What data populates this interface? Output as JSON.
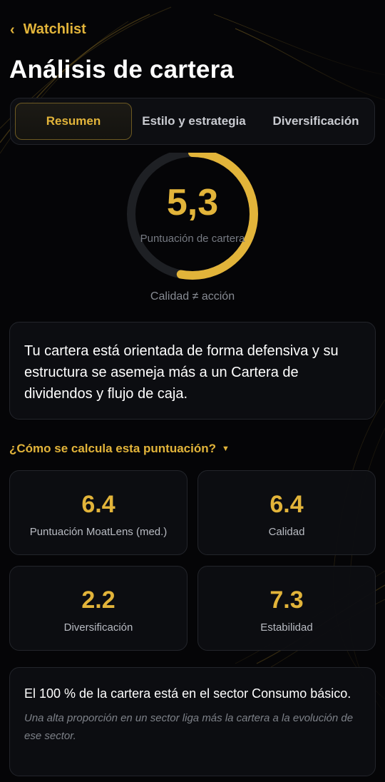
{
  "header": {
    "back_label": "Watchlist",
    "title": "Análisis de cartera"
  },
  "tabs": [
    {
      "label": "Resumen",
      "active": true
    },
    {
      "label": "Estilo y estrategia",
      "active": false
    },
    {
      "label": "Diversificación",
      "active": false
    }
  ],
  "score": {
    "value": "5,3",
    "label": "Puntuación de cartera",
    "fraction": 0.53,
    "caption": "Calidad ≠ acción"
  },
  "summary": {
    "text": "Tu cartera está orientada de forma defensiva y su estructura se asemeja más a un Cartera de dividendos y flujo de caja."
  },
  "calc_toggle": {
    "label": "¿Cómo se calcula esta puntuación?"
  },
  "metrics": [
    {
      "value": "6.4",
      "label": "Puntuación MoatLens (med.)"
    },
    {
      "value": "6.4",
      "label": "Calidad"
    },
    {
      "value": "2.2",
      "label": "Diversificación"
    },
    {
      "value": "7.3",
      "label": "Estabilidad"
    }
  ],
  "sector": {
    "main": "El 100 % de la cartera está en el sector Consumo básico.",
    "note": "Una alta proporción en un sector liga más la cartera a la evolución de ese sector."
  },
  "colors": {
    "accent": "#e2b43a",
    "background": "#050507",
    "card": "#0d0e12",
    "track": "#1e2024"
  }
}
